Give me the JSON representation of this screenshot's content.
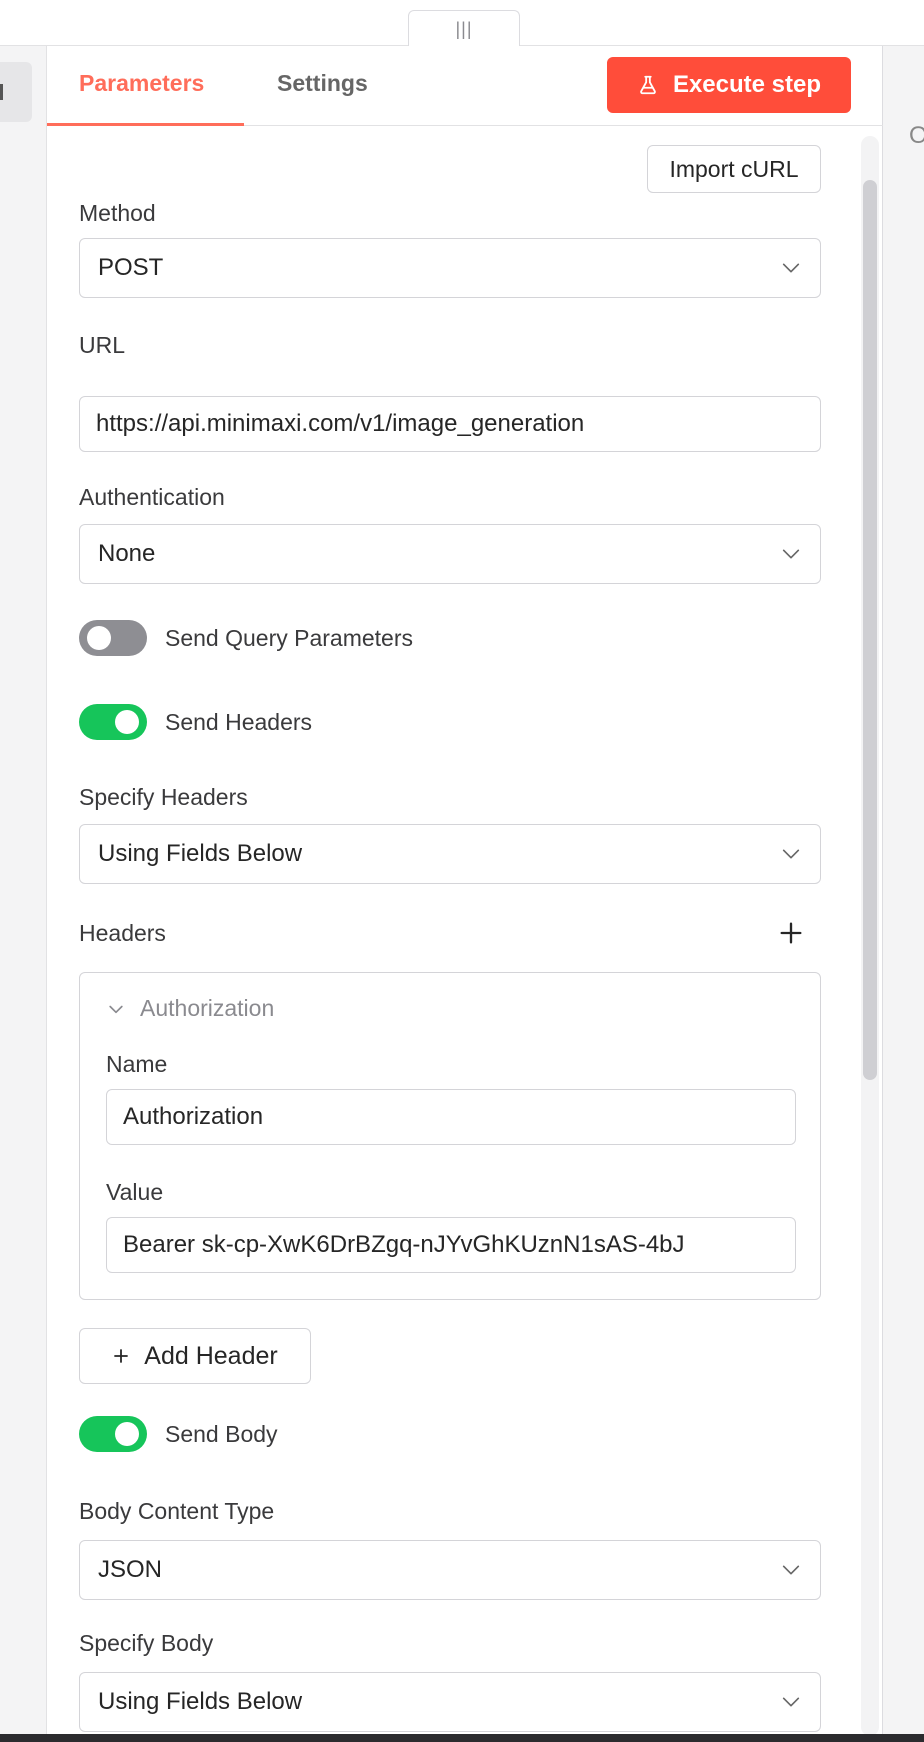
{
  "topbar": {
    "drag_handle_glyph": "|||"
  },
  "right_peek": {
    "text": "O"
  },
  "tabs": [
    {
      "label": "Parameters",
      "active": true
    },
    {
      "label": "Settings",
      "active": false
    }
  ],
  "execute_button": {
    "label": "Execute step",
    "icon": "flask-icon",
    "color": "#ff4d3a"
  },
  "import_curl_button": {
    "label": "Import cURL"
  },
  "method": {
    "label": "Method",
    "value": "POST"
  },
  "url": {
    "label": "URL",
    "value": "https://api.minimaxi.com/v1/image_generation"
  },
  "authentication": {
    "label": "Authentication",
    "value": "None"
  },
  "send_query_parameters": {
    "label": "Send Query Parameters",
    "enabled": false
  },
  "send_headers": {
    "label": "Send Headers",
    "enabled": true
  },
  "specify_headers": {
    "label": "Specify Headers",
    "value": "Using Fields Below"
  },
  "headers": {
    "label": "Headers",
    "items": [
      {
        "title": "Authorization",
        "name_label": "Name",
        "name_value": "Authorization",
        "value_label": "Value",
        "value_value": "Bearer sk-cp-XwK6DrBZgq-nJYvGhKUznN1sAS-4bJ"
      }
    ],
    "add_button_label": "Add Header"
  },
  "send_body": {
    "label": "Send Body",
    "enabled": true
  },
  "body_content_type": {
    "label": "Body Content Type",
    "value": "JSON"
  },
  "specify_body": {
    "label": "Specify Body",
    "value": "Using Fields Below"
  },
  "colors": {
    "accent": "#ff6d5a",
    "toggle_on": "#16c55a",
    "toggle_off": "#8e8e93"
  }
}
